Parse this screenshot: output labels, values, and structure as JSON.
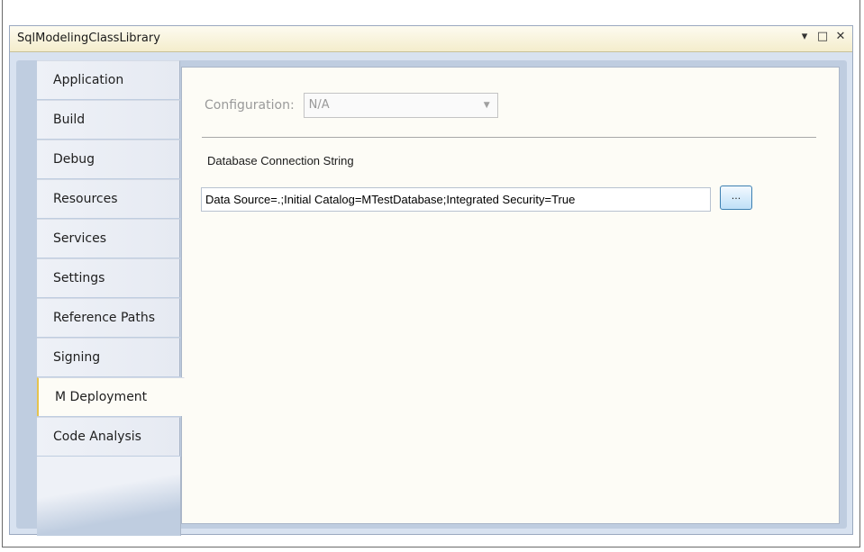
{
  "window": {
    "title": "SqlModelingClassLibrary",
    "controls": {
      "dropdown": "▾",
      "maximize": "□",
      "close": "✕"
    }
  },
  "tabs": [
    {
      "label": "Application"
    },
    {
      "label": "Build"
    },
    {
      "label": "Debug"
    },
    {
      "label": "Resources"
    },
    {
      "label": "Services"
    },
    {
      "label": "Settings"
    },
    {
      "label": "Reference Paths"
    },
    {
      "label": "Signing"
    },
    {
      "label": "M Deployment",
      "active": true
    },
    {
      "label": "Code Analysis"
    }
  ],
  "config": {
    "label": "Configuration:",
    "value": "N/A"
  },
  "db": {
    "section_label": "Database Connection String",
    "connection_string": "Data Source=.;Initial Catalog=MTestDatabase;Integrated Security=True",
    "browse_label": "..."
  },
  "colors": {
    "accent_tab": "#e5c34e",
    "window_bg": "#bfcde0",
    "title_bar": "#f4edcc"
  }
}
